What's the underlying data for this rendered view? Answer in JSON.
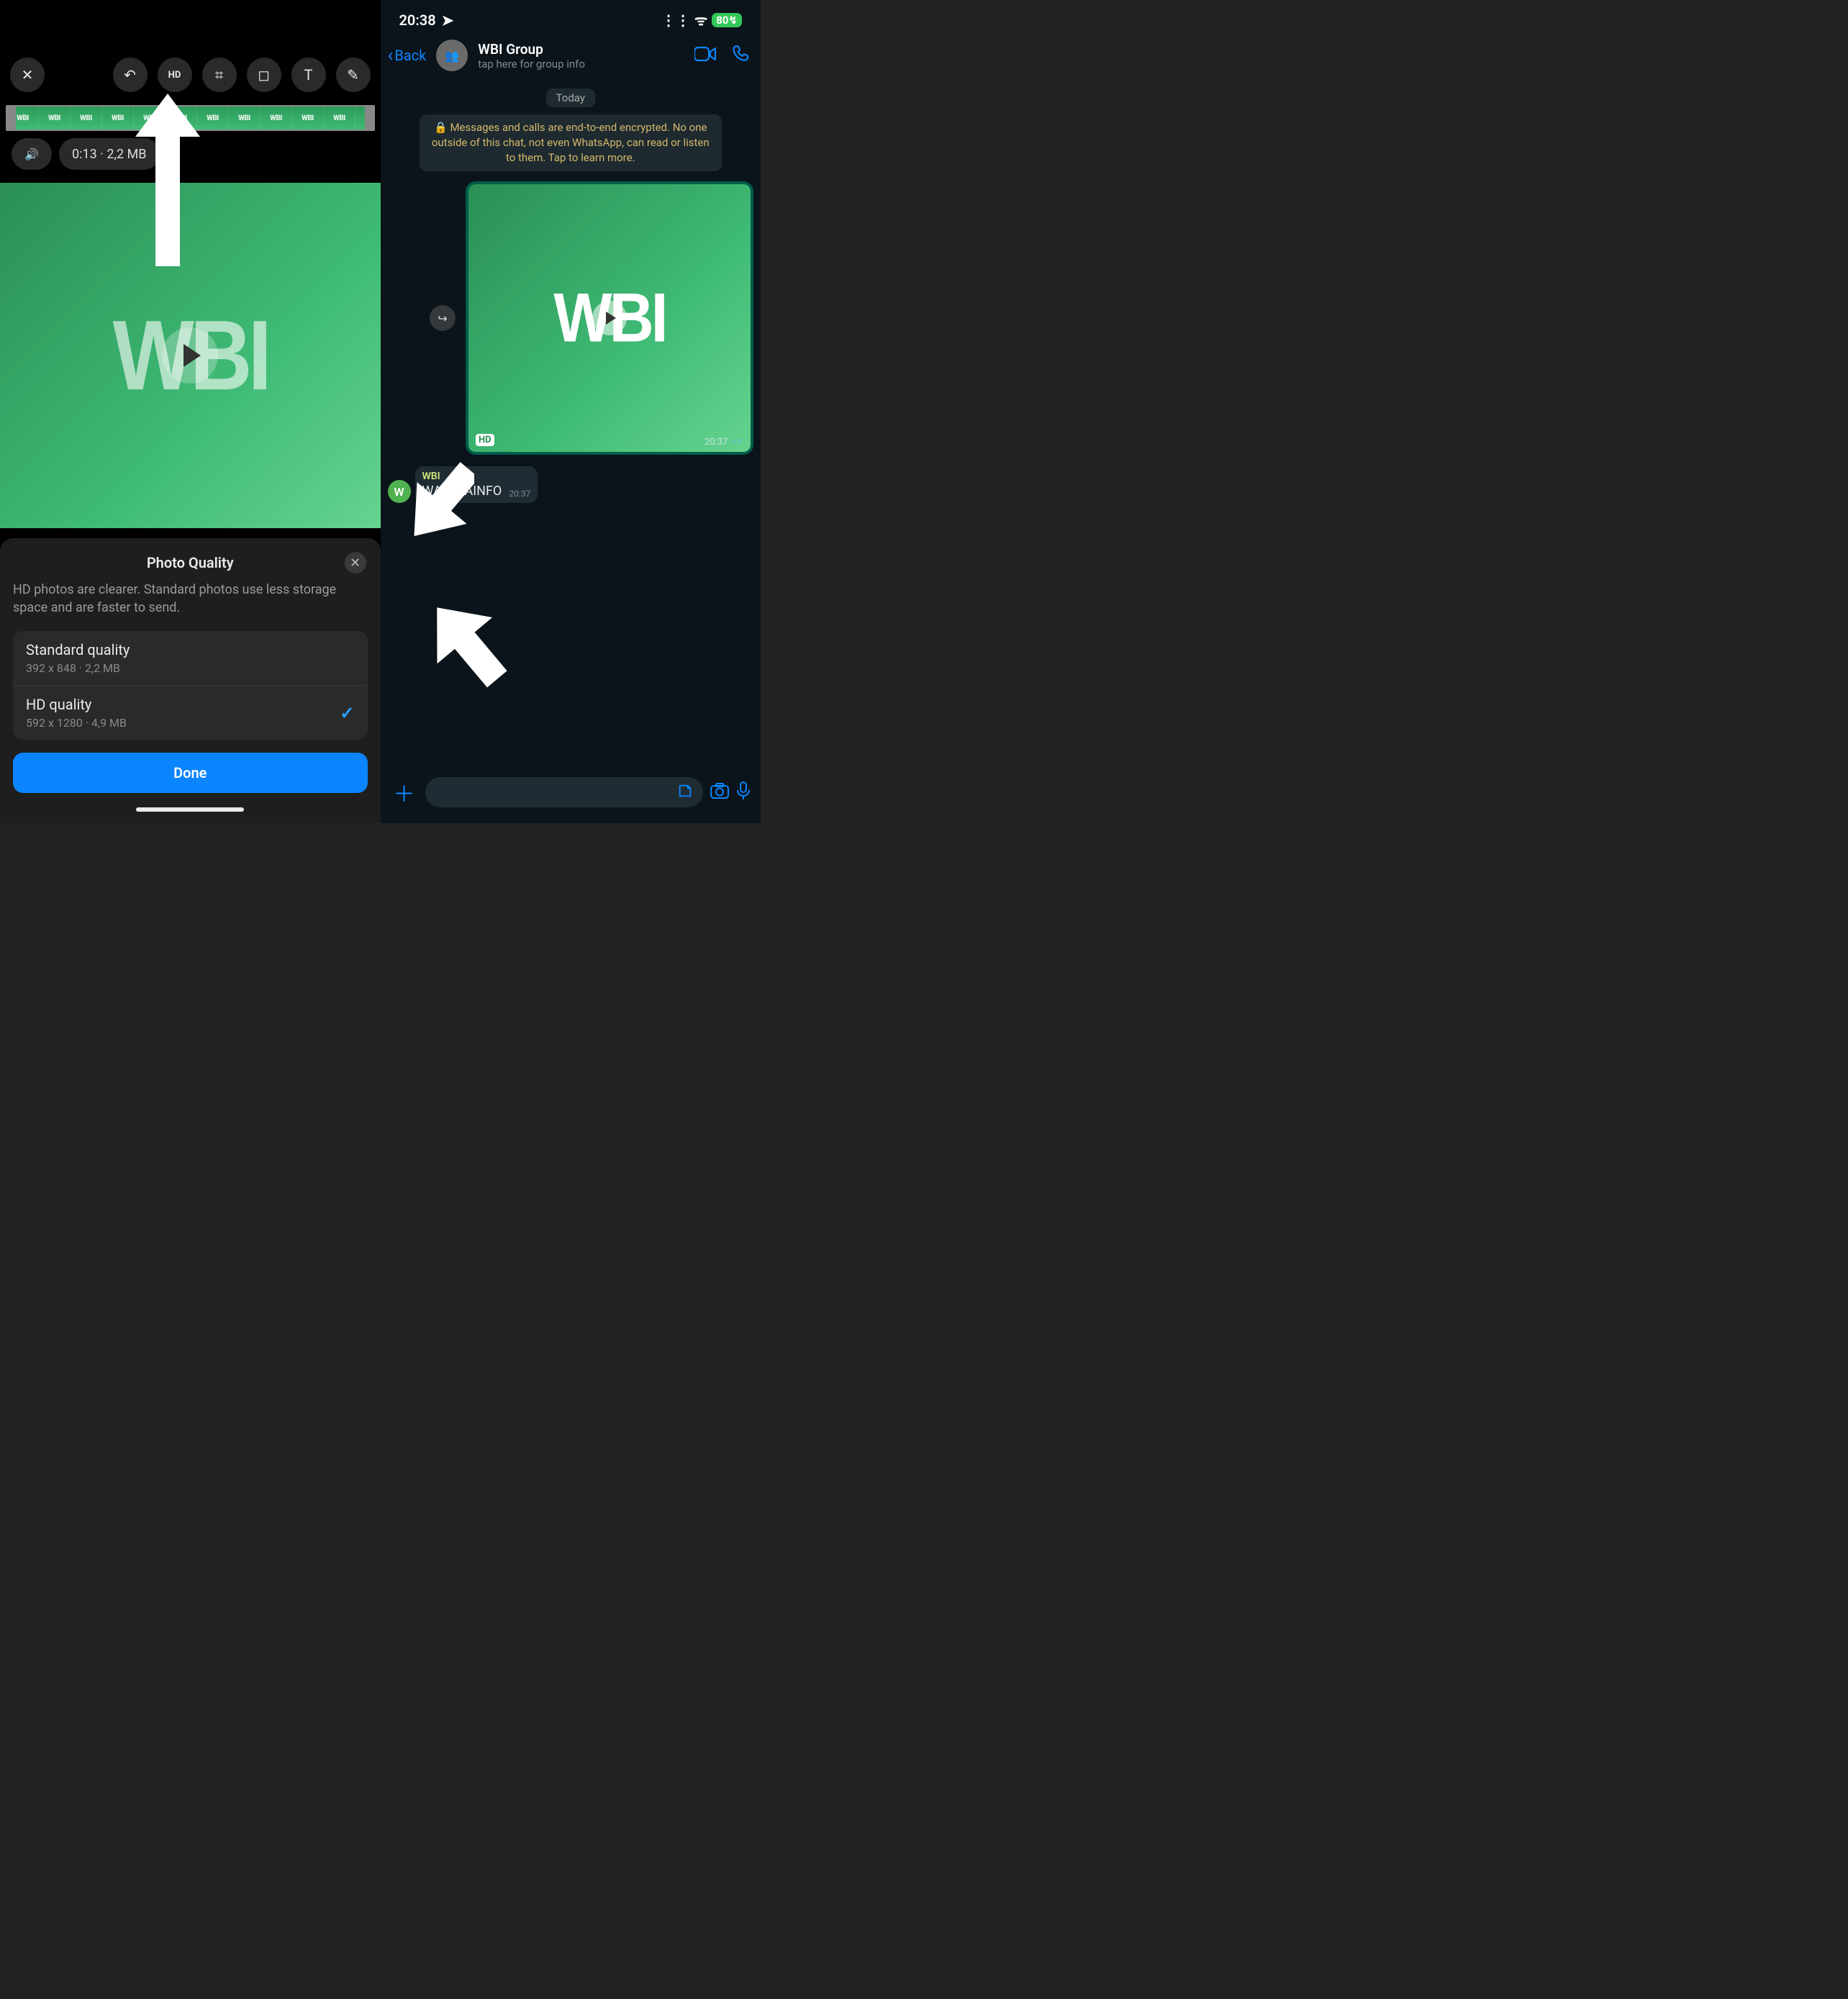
{
  "left": {
    "info_text": "0:13 · 2,2 MB",
    "frames_label": "WBI",
    "sheet": {
      "title": "Photo Quality",
      "desc": "HD photos are clearer. Standard photos use less storage space and are faster to send.",
      "options": [
        {
          "title": "Standard quality",
          "sub": "392 x 848 · 2,2 MB",
          "selected": false
        },
        {
          "title": "HD quality",
          "sub": "592 x 1280 · 4,9 MB",
          "selected": true
        }
      ],
      "done": "Done"
    }
  },
  "right": {
    "status": {
      "time": "20:38",
      "battery": "80"
    },
    "header": {
      "back": "Back",
      "title": "WBI Group",
      "subtitle": "tap here for group info"
    },
    "chat": {
      "today": "Today",
      "e2e": "Messages and calls are end-to-end encrypted. No one outside of this chat, not even WhatsApp, can read or listen to them. Tap to learn more.",
      "hd_badge": "HD",
      "out_time": "20:37",
      "sender_avatar": "W",
      "sender_name": "WBI",
      "in_text": "WABETAINFO",
      "in_time": "20:37"
    }
  },
  "icons": {
    "close": "✕",
    "undo": "↶",
    "hd": "HD",
    "crop": "⌗",
    "sticker": "◻",
    "text": "T",
    "pen": "✎",
    "volume": "🔊",
    "lock": "🔒",
    "forward": "↪",
    "video": "📹",
    "call": "📞",
    "group": "👥",
    "camera": "📷",
    "mic": "🎤",
    "emoji": "☺",
    "plus": "＋",
    "check": "✓",
    "checks": "✓✓",
    "loc": "➤",
    "back": "‹",
    "signal": "⋮⋮",
    "wifi": "ᯤ",
    "bolt": "↯"
  }
}
